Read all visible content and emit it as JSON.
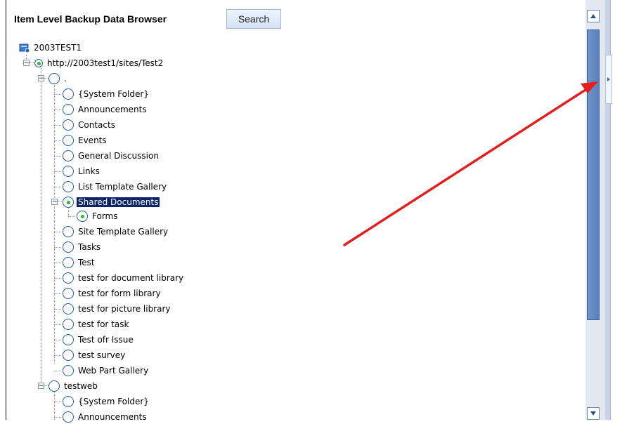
{
  "header": {
    "title": "Item Level Backup Data Browser",
    "search_label": "Search"
  },
  "tree": {
    "root": "2003TEST1",
    "site": "http://2003test1/sites/Test2",
    "web_root_label": ".",
    "items": [
      "{System Folder}",
      "Announcements",
      "Contacts",
      "Events",
      "General Discussion",
      "Links",
      "List Template Gallery",
      "Shared Documents",
      "Forms",
      "Site Template Gallery",
      "Tasks",
      "Test",
      "test for document library",
      "test for form library",
      "test for picture library",
      "test for task",
      "Test ofr Issue",
      "test survey",
      "Web Part Gallery"
    ],
    "subweb": "testweb",
    "subweb_items": [
      "{System Folder}",
      "Announcements"
    ]
  },
  "icons": {
    "site": "server-icon",
    "node": "radio-icon",
    "expand": "minus-box-icon"
  },
  "colors": {
    "selection": "#0a246a",
    "radio_border": "#1c5aa6",
    "radio_dot": "#2db52d",
    "scroll_thumb": "#5a80bb",
    "arrow": "#e02020"
  }
}
